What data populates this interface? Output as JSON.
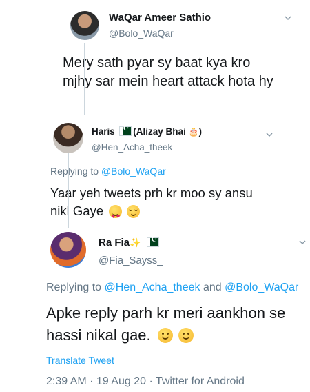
{
  "tweets": [
    {
      "name": "WaQar Ameer Sathio",
      "handle": "@Bolo_WaQar",
      "text": "Mery sath pyar sy baat kya kro mjhy sar mein heart attack hota hy"
    },
    {
      "name": "Haris",
      "name_suffix_open": " (Alizay Bhai ",
      "name_suffix_close": ")",
      "name_emoji": "🎂",
      "handle": "@Hen_Acha_theek",
      "replying_prefix": "Replying to ",
      "replying_to": "@Bolo_WaQar",
      "text": "Yaar yeh tweets prh kr moo sy ansu nikl Gaye",
      "emojis": [
        "heart-eyes-emoji",
        "relieved-emoji"
      ]
    },
    {
      "name": "Ra Fia",
      "name_emoji": "✨",
      "handle": "@Fia_Sayss_",
      "replying_prefix": "Replying to ",
      "replying_to_1": "@Hen_Acha_theek",
      "replying_and": " and ",
      "replying_to_2": "@Bolo_WaQar",
      "text": "Apke reply parh kr meri aankhon se hassi nikal gae.",
      "emojis": [
        "slight-smile-emoji",
        "slight-smile-emoji"
      ],
      "translate_label": "Translate Tweet",
      "timestamp": "2:39 AM · 19 Aug 20 · Twitter for Android"
    }
  ],
  "colors": {
    "text": "#14171a",
    "secondary": "#657786",
    "link": "#1da1f2",
    "thread_line": "#ccd6dd"
  }
}
